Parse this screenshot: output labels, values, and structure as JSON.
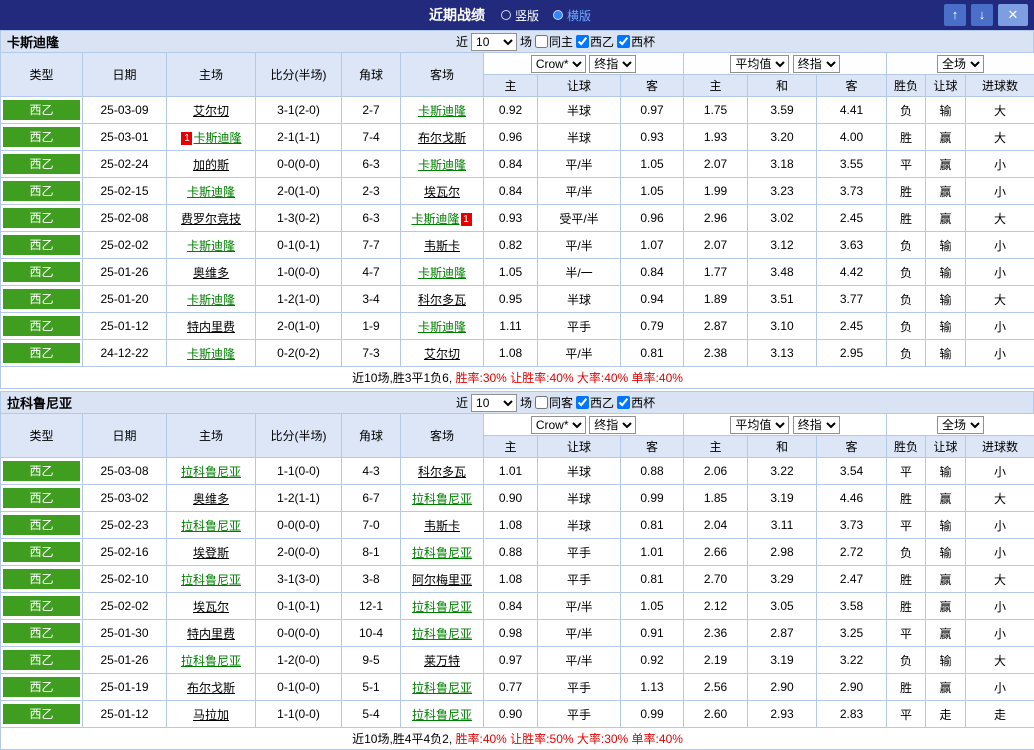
{
  "header": {
    "title": "近期战绩",
    "vertical_label": "竖版",
    "horizontal_label": "横版",
    "up_icon": "↑",
    "down_icon": "↓",
    "close_icon": "✕",
    "bar_color": "#212a7c",
    "accent_color": "#2f86ff"
  },
  "colors": {
    "win": "#e60000",
    "lose": "#0000d0",
    "draw": "#008800",
    "focus_team": "#008000",
    "league_badge": "#3f9e1f",
    "score": "#e60000"
  },
  "sections": [
    {
      "team": "卡斯迪隆",
      "filter": {
        "near_label": "近",
        "games_value": "10",
        "games_label": "场",
        "same_label": "同主",
        "league_label": "西乙",
        "cup_label": "西杯"
      },
      "controls": {
        "company": "Crow*",
        "stage": "终指",
        "avg": "平均值",
        "stage2": "终指",
        "scope": "全场"
      },
      "columns": [
        "类型",
        "日期",
        "主场",
        "比分(半场)",
        "角球",
        "客场",
        "主",
        "让球",
        "客",
        "主",
        "和",
        "客",
        "胜负",
        "让球",
        "进球数"
      ],
      "rows": [
        {
          "league": "西乙",
          "date": "25-03-09",
          "home": {
            "name": "艾尔切",
            "focus": false
          },
          "score": "3-1(2-0)",
          "corner": "2-7",
          "away": {
            "name": "卡斯迪隆",
            "focus": true
          },
          "asia": [
            "0.92",
            "半球",
            "0.97"
          ],
          "euro": [
            "1.75",
            "3.59",
            "4.41"
          ],
          "results": [
            "负",
            "输",
            "大"
          ]
        },
        {
          "league": "西乙",
          "date": "25-03-01",
          "home": {
            "name": "卡斯迪隆",
            "focus": true,
            "card": "1",
            "card_side": "left"
          },
          "score": "2-1(1-1)",
          "corner": "7-4",
          "away": {
            "name": "布尔戈斯",
            "focus": false
          },
          "asia": [
            "0.96",
            "半球",
            "0.93"
          ],
          "euro": [
            "1.93",
            "3.20",
            "4.00"
          ],
          "results": [
            "胜",
            "赢",
            "大"
          ]
        },
        {
          "league": "西乙",
          "date": "25-02-24",
          "home": {
            "name": "加的斯",
            "focus": false
          },
          "score": "0-0(0-0)",
          "corner": "6-3",
          "away": {
            "name": "卡斯迪隆",
            "focus": true
          },
          "asia": [
            "0.84",
            "平/半",
            "1.05"
          ],
          "euro": [
            "2.07",
            "3.18",
            "3.55"
          ],
          "results": [
            "平",
            "赢",
            "小"
          ]
        },
        {
          "league": "西乙",
          "date": "25-02-15",
          "home": {
            "name": "卡斯迪隆",
            "focus": true
          },
          "score": "2-0(1-0)",
          "corner": "2-3",
          "away": {
            "name": "埃瓦尔",
            "focus": false
          },
          "asia": [
            "0.84",
            "平/半",
            "1.05"
          ],
          "euro": [
            "1.99",
            "3.23",
            "3.73"
          ],
          "results": [
            "胜",
            "赢",
            "小"
          ]
        },
        {
          "league": "西乙",
          "date": "25-02-08",
          "home": {
            "name": "费罗尔竞技",
            "focus": false
          },
          "score": "1-3(0-2)",
          "corner": "6-3",
          "away": {
            "name": "卡斯迪隆",
            "focus": true,
            "card": "1",
            "card_side": "right"
          },
          "asia": [
            "0.93",
            "受平/半",
            "0.96"
          ],
          "euro": [
            "2.96",
            "3.02",
            "2.45"
          ],
          "results": [
            "胜",
            "赢",
            "大"
          ]
        },
        {
          "league": "西乙",
          "date": "25-02-02",
          "home": {
            "name": "卡斯迪隆",
            "focus": true
          },
          "score": "0-1(0-1)",
          "corner": "7-7",
          "away": {
            "name": "韦斯卡",
            "focus": false
          },
          "asia": [
            "0.82",
            "平/半",
            "1.07"
          ],
          "euro": [
            "2.07",
            "3.12",
            "3.63"
          ],
          "results": [
            "负",
            "输",
            "小"
          ]
        },
        {
          "league": "西乙",
          "date": "25-01-26",
          "home": {
            "name": "奥维多",
            "focus": false
          },
          "score": "1-0(0-0)",
          "corner": "4-7",
          "away": {
            "name": "卡斯迪隆",
            "focus": true
          },
          "asia": [
            "1.05",
            "半/一",
            "0.84"
          ],
          "euro": [
            "1.77",
            "3.48",
            "4.42"
          ],
          "results": [
            "负",
            "输",
            "小"
          ]
        },
        {
          "league": "西乙",
          "date": "25-01-20",
          "home": {
            "name": "卡斯迪隆",
            "focus": true
          },
          "score": "1-2(1-0)",
          "corner": "3-4",
          "away": {
            "name": "科尔多瓦",
            "focus": false
          },
          "asia": [
            "0.95",
            "半球",
            "0.94"
          ],
          "euro": [
            "1.89",
            "3.51",
            "3.77"
          ],
          "results": [
            "负",
            "输",
            "大"
          ]
        },
        {
          "league": "西乙",
          "date": "25-01-12",
          "home": {
            "name": "特内里费",
            "focus": false
          },
          "score": "2-0(1-0)",
          "corner": "1-9",
          "away": {
            "name": "卡斯迪隆",
            "focus": true
          },
          "asia": [
            "1.11",
            "平手",
            "0.79"
          ],
          "euro": [
            "2.87",
            "3.10",
            "2.45"
          ],
          "results": [
            "负",
            "输",
            "小"
          ]
        },
        {
          "league": "西乙",
          "date": "24-12-22",
          "home": {
            "name": "卡斯迪隆",
            "focus": true
          },
          "score": "0-2(0-2)",
          "corner": "7-3",
          "away": {
            "name": "艾尔切",
            "focus": false
          },
          "asia": [
            "1.08",
            "平/半",
            "0.81"
          ],
          "euro": [
            "2.38",
            "3.13",
            "2.95"
          ],
          "results": [
            "负",
            "输",
            "小"
          ]
        }
      ],
      "summary": {
        "record": "近10场,胜3平1负6,",
        "rates": "胜率:30% 让胜率:40% 大率:40% 单率:40%"
      }
    },
    {
      "team": "拉科鲁尼亚",
      "filter": {
        "near_label": "近",
        "games_value": "10",
        "games_label": "场",
        "same_label": "同客",
        "league_label": "西乙",
        "cup_label": "西杯"
      },
      "controls": {
        "company": "Crow*",
        "stage": "终指",
        "avg": "平均值",
        "stage2": "终指",
        "scope": "全场"
      },
      "columns": [
        "类型",
        "日期",
        "主场",
        "比分(半场)",
        "角球",
        "客场",
        "主",
        "让球",
        "客",
        "主",
        "和",
        "客",
        "胜负",
        "让球",
        "进球数"
      ],
      "rows": [
        {
          "league": "西乙",
          "date": "25-03-08",
          "home": {
            "name": "拉科鲁尼亚",
            "focus": true
          },
          "score": "1-1(0-0)",
          "corner": "4-3",
          "away": {
            "name": "科尔多瓦",
            "focus": false
          },
          "asia": [
            "1.01",
            "半球",
            "0.88"
          ],
          "euro": [
            "2.06",
            "3.22",
            "3.54"
          ],
          "results": [
            "平",
            "输",
            "小"
          ]
        },
        {
          "league": "西乙",
          "date": "25-03-02",
          "home": {
            "name": "奥维多",
            "focus": false
          },
          "score": "1-2(1-1)",
          "corner": "6-7",
          "away": {
            "name": "拉科鲁尼亚",
            "focus": true
          },
          "asia": [
            "0.90",
            "半球",
            "0.99"
          ],
          "euro": [
            "1.85",
            "3.19",
            "4.46"
          ],
          "results": [
            "胜",
            "赢",
            "大"
          ]
        },
        {
          "league": "西乙",
          "date": "25-02-23",
          "home": {
            "name": "拉科鲁尼亚",
            "focus": true
          },
          "score": "0-0(0-0)",
          "corner": "7-0",
          "away": {
            "name": "韦斯卡",
            "focus": false
          },
          "asia": [
            "1.08",
            "半球",
            "0.81"
          ],
          "euro": [
            "2.04",
            "3.11",
            "3.73"
          ],
          "results": [
            "平",
            "输",
            "小"
          ]
        },
        {
          "league": "西乙",
          "date": "25-02-16",
          "home": {
            "name": "埃登斯",
            "focus": false
          },
          "score": "2-0(0-0)",
          "corner": "8-1",
          "away": {
            "name": "拉科鲁尼亚",
            "focus": true
          },
          "asia": [
            "0.88",
            "平手",
            "1.01"
          ],
          "euro": [
            "2.66",
            "2.98",
            "2.72"
          ],
          "results": [
            "负",
            "输",
            "小"
          ]
        },
        {
          "league": "西乙",
          "date": "25-02-10",
          "home": {
            "name": "拉科鲁尼亚",
            "focus": true
          },
          "score": "3-1(3-0)",
          "corner": "3-8",
          "away": {
            "name": "阿尔梅里亚",
            "focus": false
          },
          "asia": [
            "1.08",
            "平手",
            "0.81"
          ],
          "euro": [
            "2.70",
            "3.29",
            "2.47"
          ],
          "results": [
            "胜",
            "赢",
            "大"
          ]
        },
        {
          "league": "西乙",
          "date": "25-02-02",
          "home": {
            "name": "埃瓦尔",
            "focus": false
          },
          "score": "0-1(0-1)",
          "corner": "12-1",
          "away": {
            "name": "拉科鲁尼亚",
            "focus": true
          },
          "asia": [
            "0.84",
            "平/半",
            "1.05"
          ],
          "euro": [
            "2.12",
            "3.05",
            "3.58"
          ],
          "results": [
            "胜",
            "赢",
            "小"
          ]
        },
        {
          "league": "西乙",
          "date": "25-01-30",
          "home": {
            "name": "特内里费",
            "focus": false
          },
          "score": "0-0(0-0)",
          "corner": "10-4",
          "away": {
            "name": "拉科鲁尼亚",
            "focus": true
          },
          "asia": [
            "0.98",
            "平/半",
            "0.91"
          ],
          "euro": [
            "2.36",
            "2.87",
            "3.25"
          ],
          "results": [
            "平",
            "赢",
            "小"
          ]
        },
        {
          "league": "西乙",
          "date": "25-01-26",
          "home": {
            "name": "拉科鲁尼亚",
            "focus": true
          },
          "score": "1-2(0-0)",
          "corner": "9-5",
          "away": {
            "name": "莱万特",
            "focus": false
          },
          "asia": [
            "0.97",
            "平/半",
            "0.92"
          ],
          "euro": [
            "2.19",
            "3.19",
            "3.22"
          ],
          "results": [
            "负",
            "输",
            "大"
          ]
        },
        {
          "league": "西乙",
          "date": "25-01-19",
          "home": {
            "name": "布尔戈斯",
            "focus": false
          },
          "score": "0-1(0-0)",
          "corner": "5-1",
          "away": {
            "name": "拉科鲁尼亚",
            "focus": true
          },
          "asia": [
            "0.77",
            "平手",
            "1.13"
          ],
          "euro": [
            "2.56",
            "2.90",
            "2.90"
          ],
          "results": [
            "胜",
            "赢",
            "小"
          ]
        },
        {
          "league": "西乙",
          "date": "25-01-12",
          "home": {
            "name": "马拉加",
            "focus": false
          },
          "score": "1-1(0-0)",
          "corner": "5-4",
          "away": {
            "name": "拉科鲁尼亚",
            "focus": true
          },
          "asia": [
            "0.90",
            "平手",
            "0.99"
          ],
          "euro": [
            "2.60",
            "2.93",
            "2.83"
          ],
          "results": [
            "平",
            "走",
            "走"
          ]
        }
      ],
      "summary": {
        "record": "近10场,胜4平4负2,",
        "rates": "胜率:40% 让胜率:50% 大率:30% 单率:40%"
      }
    }
  ]
}
